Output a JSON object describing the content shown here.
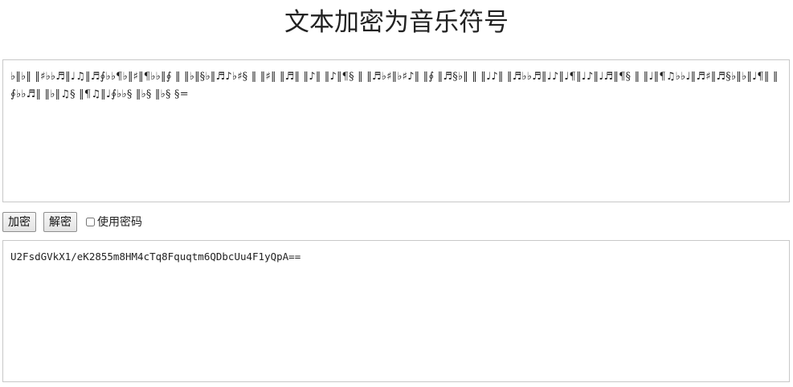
{
  "page": {
    "title": "文本加密为音乐符号"
  },
  "input": {
    "text": "♭‖♭‖ ‖♯♭♭♬‖♩♫‖♬∮♭♭¶♭‖♯‖¶♭♭‖∮ ‖ ‖♭‖§♭‖♬♪♭♯§ ‖ ‖♯‖ ‖♬‖ ‖♪‖ ‖♪‖¶§ ‖ ‖♬♭♯‖♭♯♪‖ ‖∮ ‖♬§♭‖ ‖ ‖♩♪‖ ‖♬♭♭♬‖♩♪‖♩¶‖♩♪‖♩♬‖¶§ ‖ ‖♩‖¶♫♭♭♩‖♬♯‖♬§♭‖♭‖♩¶‖ ‖∮♭♭♬‖ ‖♭‖♫§ ‖¶♫‖♩∮♭♭§ ‖♭§ ‖♭§ §="
  },
  "controls": {
    "encrypt_label": "加密",
    "decrypt_label": "解密",
    "use_password_label": "使用密码",
    "use_password_checked": false
  },
  "output": {
    "text": "U2FsdGVkX1/eK2855m8HM4cTq8Fquqtm6QDbcUu4F1yQpA=="
  }
}
